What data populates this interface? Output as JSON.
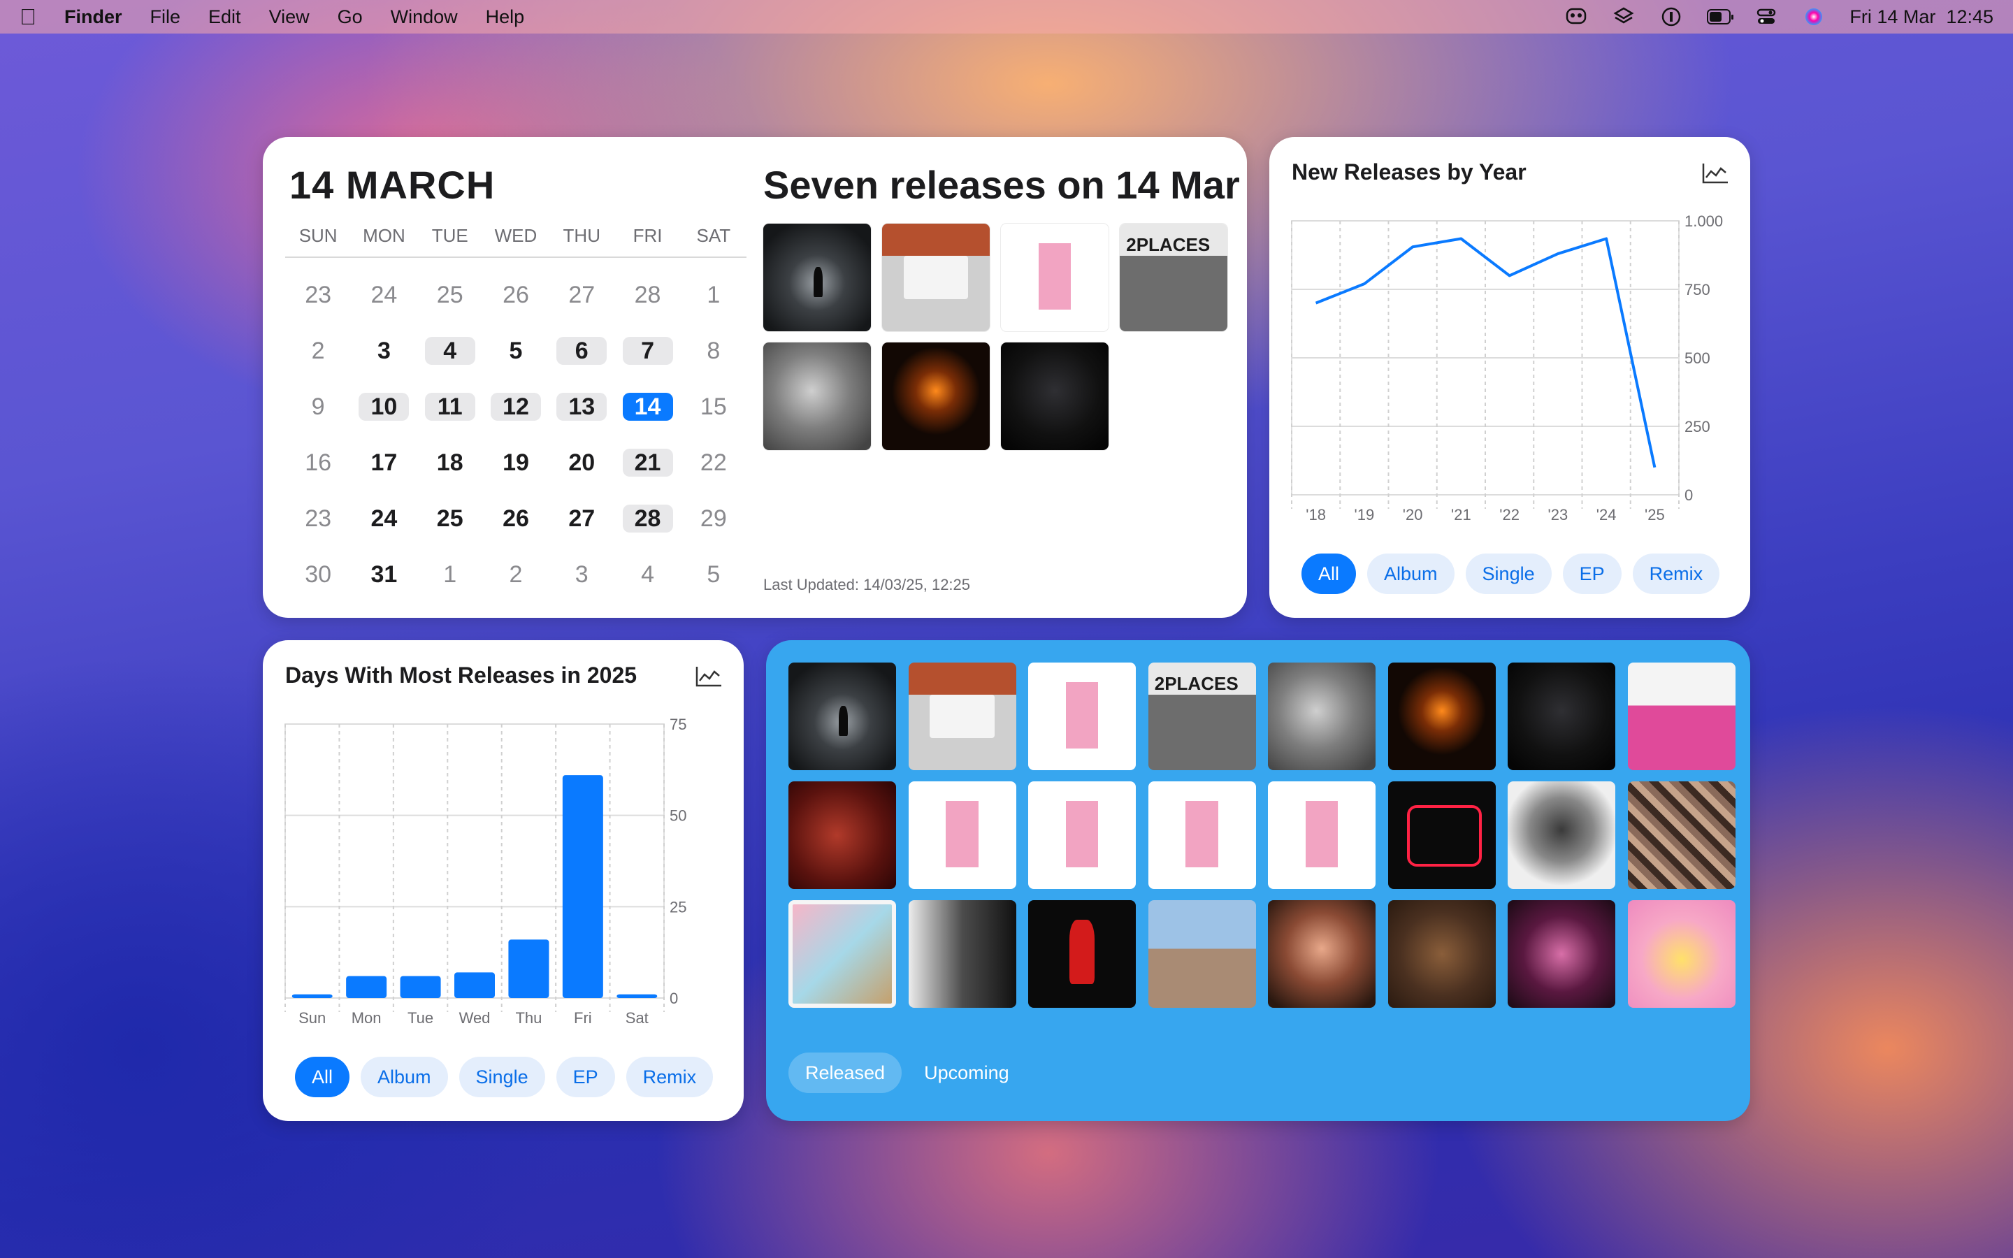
{
  "menubar": {
    "app_name": "Finder",
    "menus": [
      "File",
      "Edit",
      "View",
      "Go",
      "Window",
      "Help"
    ],
    "clock": "Fri 14 Mar  12:45",
    "status_icons": [
      "controlcenter-mask-icon",
      "layers-icon",
      "onepassword-icon",
      "battery-icon",
      "control-center-icon",
      "siri-icon"
    ]
  },
  "calendar": {
    "title": "14 MARCH",
    "weekdays": [
      "SUN",
      "MON",
      "TUE",
      "WED",
      "THU",
      "FRI",
      "SAT"
    ],
    "weeks": [
      [
        {
          "d": "23",
          "t": "other"
        },
        {
          "d": "24",
          "t": "other"
        },
        {
          "d": "25",
          "t": "other"
        },
        {
          "d": "26",
          "t": "other"
        },
        {
          "d": "27",
          "t": "other"
        },
        {
          "d": "28",
          "t": "other"
        },
        {
          "d": "1",
          "t": "wk"
        }
      ],
      [
        {
          "d": "2",
          "t": "wk"
        },
        {
          "d": "3",
          "t": "cur"
        },
        {
          "d": "4",
          "t": "cur hl"
        },
        {
          "d": "5",
          "t": "cur"
        },
        {
          "d": "6",
          "t": "cur hl"
        },
        {
          "d": "7",
          "t": "cur hl"
        },
        {
          "d": "8",
          "t": "wk"
        }
      ],
      [
        {
          "d": "9",
          "t": "wk"
        },
        {
          "d": "10",
          "t": "cur hl"
        },
        {
          "d": "11",
          "t": "cur hl"
        },
        {
          "d": "12",
          "t": "cur hl"
        },
        {
          "d": "13",
          "t": "cur hl"
        },
        {
          "d": "14",
          "t": "today"
        },
        {
          "d": "15",
          "t": "wk"
        }
      ],
      [
        {
          "d": "16",
          "t": "wk"
        },
        {
          "d": "17",
          "t": "cur"
        },
        {
          "d": "18",
          "t": "cur"
        },
        {
          "d": "19",
          "t": "cur"
        },
        {
          "d": "20",
          "t": "cur"
        },
        {
          "d": "21",
          "t": "cur hl"
        },
        {
          "d": "22",
          "t": "wk"
        }
      ],
      [
        {
          "d": "23",
          "t": "wk"
        },
        {
          "d": "24",
          "t": "cur"
        },
        {
          "d": "25",
          "t": "cur"
        },
        {
          "d": "26",
          "t": "cur"
        },
        {
          "d": "27",
          "t": "cur"
        },
        {
          "d": "28",
          "t": "cur hl"
        },
        {
          "d": "29",
          "t": "wk"
        }
      ],
      [
        {
          "d": "30",
          "t": "wk"
        },
        {
          "d": "31",
          "t": "cur"
        },
        {
          "d": "1",
          "t": "other"
        },
        {
          "d": "2",
          "t": "other"
        },
        {
          "d": "3",
          "t": "other"
        },
        {
          "d": "4",
          "t": "other"
        },
        {
          "d": "5",
          "t": "other"
        }
      ]
    ]
  },
  "releases_today": {
    "title": "Seven releases on 14 Mar",
    "covers": [
      "c-shadow",
      "c-brick",
      "c-pink",
      "c-2places",
      "c-bald",
      "c-fire",
      "c-dark"
    ],
    "last_updated": "Last Updated: 14/03/25, 12:25"
  },
  "yearly_chart": {
    "title": "New Releases by Year",
    "filters": [
      "All",
      "Album",
      "Single",
      "EP",
      "Remix"
    ],
    "active_filter": "All"
  },
  "weekday_chart": {
    "title": "Days With Most Releases in 2025",
    "filters": [
      "All",
      "Album",
      "Single",
      "EP",
      "Remix"
    ],
    "active_filter": "All"
  },
  "release_grid": {
    "covers": [
      "c-shadow",
      "c-brick",
      "c-pink",
      "c-2places",
      "c-bald",
      "c-fire",
      "c-dark",
      "c-og",
      "c-red",
      "c-pink",
      "c-pink",
      "c-pink",
      "c-pink",
      "c-neon",
      "c-face",
      "c-collage",
      "c-dog",
      "c-bw",
      "c-redhair",
      "c-motel",
      "c-lisa",
      "c-curly",
      "c-hello",
      "c-heart"
    ],
    "tabs": [
      "Released",
      "Upcoming"
    ],
    "active_tab": "Released"
  },
  "chart_data": [
    {
      "type": "line",
      "title": "New Releases by Year",
      "x": [
        "'18",
        "'19",
        "'20",
        "'21",
        "'22",
        "'23",
        "'24",
        "'25"
      ],
      "series": [
        {
          "values": [
            700,
            770,
            905,
            935,
            800,
            880,
            935,
            100
          ]
        }
      ],
      "ylim": [
        0,
        1000
      ],
      "yticks": [
        "0",
        "250",
        "500",
        "750",
        "1.000"
      ],
      "grid": true,
      "color": "#0a7aff"
    },
    {
      "type": "bar",
      "title": "Days With Most Releases in 2025",
      "categories": [
        "Sun",
        "Mon",
        "Tue",
        "Wed",
        "Thu",
        "Fri",
        "Sat"
      ],
      "values": [
        1,
        6,
        6,
        7,
        16,
        61,
        1
      ],
      "ylim": [
        0,
        75
      ],
      "yticks": [
        "0",
        "25",
        "50",
        "75"
      ],
      "grid": true,
      "color": "#0a7aff"
    }
  ]
}
